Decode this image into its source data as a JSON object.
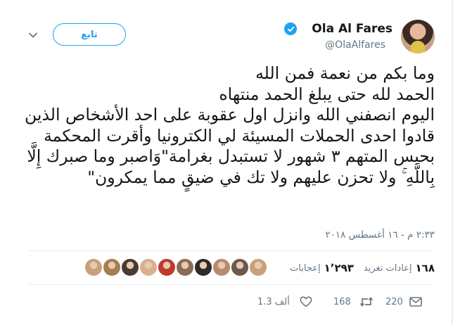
{
  "user": {
    "display_name": "Ola Al Fares",
    "handle": "@OlaAlfares",
    "verified": true
  },
  "follow_button_label": "تابع",
  "tweet": {
    "lines": [
      "وما بكم من نعمة فمن الله",
      "الحمد لله حتى يبلغ الحمد منتهاه",
      "اليوم انصفني الله وانزل اول عقوبة على احد الأشخاص الذين قادوا احدى الحملات المسيئة لي الكترونيا  وأقرت المحكمة بحبس المتهم ٣ شهور لا تستبدل بغرامة\"وَاصبر وما صبرك إِلَّا بِاللَّهِ ۚ ولا تحزن عليهم ولا تك في ضيقٍ مما يمكرون\""
    ],
    "timestamp": "٢:٣٣ م - ١٦ أغسطس ٢٠١٨"
  },
  "stats": {
    "retweets_count": "١٦٨",
    "retweets_label": "إعادات تغريد",
    "likes_count": "١٬٢٩٣",
    "likes_label": "إعجابات"
  },
  "likers": [
    {
      "color": "#c9a07a"
    },
    {
      "color": "#6b5a4d"
    },
    {
      "color": "#b88a6f"
    },
    {
      "color": "#2d2a28"
    },
    {
      "color": "#8a6b55"
    },
    {
      "color": "#c0392b"
    },
    {
      "color": "#d9b08c"
    },
    {
      "color": "#4a3b32"
    },
    {
      "color": "#a67c52"
    },
    {
      "color": "#c9a07a"
    }
  ],
  "actions": {
    "reply_count": "220",
    "retweet_count": "168",
    "like_count": "1.3 ألف"
  },
  "colors": {
    "accent": "#1da1f2",
    "text": "#14171a",
    "muted": "#657786",
    "border": "#e6ecf0"
  },
  "icons": {
    "verified": "verified-badge-icon",
    "more": "chevron-down-icon",
    "reply": "reply-icon",
    "retweet": "retweet-icon",
    "like": "heart-icon",
    "message": "envelope-icon"
  }
}
